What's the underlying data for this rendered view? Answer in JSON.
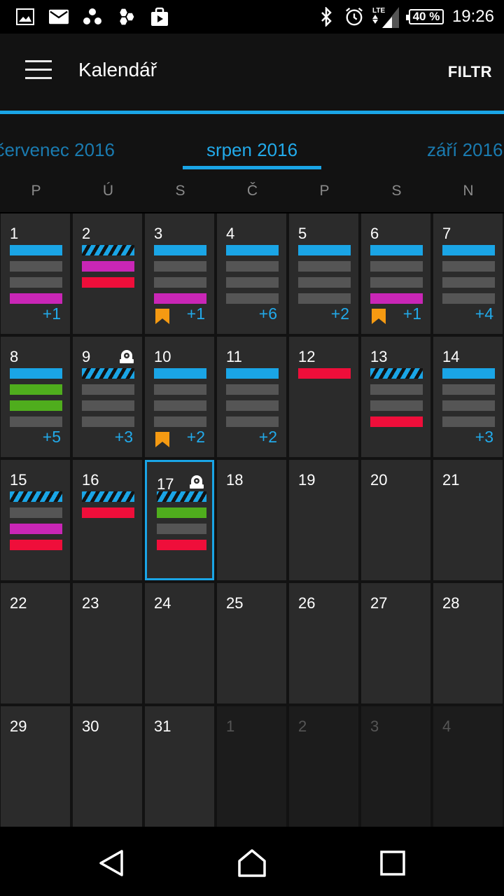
{
  "status_bar": {
    "battery": "40 %",
    "time": "19:26",
    "network": "LTE",
    "icons_left": [
      "image-icon",
      "mail-icon",
      "apps-icon",
      "hexagon-icon",
      "store-icon"
    ],
    "icons_right": [
      "bluetooth-icon",
      "alarm-icon",
      "lte-signal-icon",
      "battery-icon"
    ]
  },
  "app_bar": {
    "title": "Kalendář",
    "filter_label": "FILTR"
  },
  "month_tabs": {
    "prev": "červenec 2016",
    "current": "srpen 2016",
    "next": "září 2016"
  },
  "weekdays": [
    "P",
    "Ú",
    "S",
    "Č",
    "P",
    "S",
    "N"
  ],
  "colors": {
    "accent": "#1aa5e6",
    "gray_event": "#555555",
    "magenta_event": "#c926b6",
    "red_event": "#ef0e3a",
    "green_event": "#4fad1d",
    "bookmark": "#f59a12"
  },
  "calendar": {
    "today": "17",
    "weeks": [
      [
        {
          "day": "1",
          "events": [
            "blue",
            "gray",
            "gray",
            "magenta"
          ],
          "more": "+1",
          "bookmark": false,
          "alarm": false
        },
        {
          "day": "2",
          "events": [
            "striped",
            "magenta",
            "red"
          ],
          "more": "",
          "bookmark": false,
          "alarm": false
        },
        {
          "day": "3",
          "events": [
            "blue",
            "gray",
            "gray",
            "magenta"
          ],
          "more": "+1",
          "bookmark": true,
          "alarm": false
        },
        {
          "day": "4",
          "events": [
            "blue",
            "gray",
            "gray",
            "gray"
          ],
          "more": "+6",
          "bookmark": false,
          "alarm": false
        },
        {
          "day": "5",
          "events": [
            "blue",
            "gray",
            "gray",
            "gray"
          ],
          "more": "+2",
          "bookmark": false,
          "alarm": false
        },
        {
          "day": "6",
          "events": [
            "blue",
            "gray",
            "gray",
            "magenta"
          ],
          "more": "+1",
          "bookmark": true,
          "alarm": false
        },
        {
          "day": "7",
          "events": [
            "blue",
            "gray",
            "gray",
            "gray"
          ],
          "more": "+4",
          "bookmark": false,
          "alarm": false
        }
      ],
      [
        {
          "day": "8",
          "events": [
            "blue",
            "green",
            "green",
            "gray"
          ],
          "more": "+5",
          "bookmark": false,
          "alarm": false
        },
        {
          "day": "9",
          "events": [
            "striped",
            "gray",
            "gray",
            "gray"
          ],
          "more": "+3",
          "bookmark": false,
          "alarm": true
        },
        {
          "day": "10",
          "events": [
            "blue",
            "gray",
            "gray",
            "gray"
          ],
          "more": "+2",
          "bookmark": true,
          "alarm": false
        },
        {
          "day": "11",
          "events": [
            "blue",
            "gray",
            "gray",
            "gray"
          ],
          "more": "+2",
          "bookmark": false,
          "alarm": false
        },
        {
          "day": "12",
          "events": [
            "red"
          ],
          "more": "",
          "bookmark": false,
          "alarm": false
        },
        {
          "day": "13",
          "events": [
            "striped",
            "gray",
            "gray",
            "red"
          ],
          "more": "",
          "bookmark": false,
          "alarm": false
        },
        {
          "day": "14",
          "events": [
            "blue",
            "gray",
            "gray",
            "gray"
          ],
          "more": "+3",
          "bookmark": false,
          "alarm": false
        }
      ],
      [
        {
          "day": "15",
          "events": [
            "striped",
            "gray",
            "magenta",
            "red"
          ],
          "more": "",
          "bookmark": false,
          "alarm": false
        },
        {
          "day": "16",
          "events": [
            "striped",
            "red"
          ],
          "more": "",
          "bookmark": false,
          "alarm": false
        },
        {
          "day": "17",
          "events": [
            "striped",
            "green",
            "gray",
            "red"
          ],
          "more": "",
          "bookmark": false,
          "alarm": true
        },
        {
          "day": "18",
          "events": [],
          "more": "",
          "bookmark": false,
          "alarm": false
        },
        {
          "day": "19",
          "events": [],
          "more": "",
          "bookmark": false,
          "alarm": false
        },
        {
          "day": "20",
          "events": [],
          "more": "",
          "bookmark": false,
          "alarm": false
        },
        {
          "day": "21",
          "events": [],
          "more": "",
          "bookmark": false,
          "alarm": false
        }
      ],
      [
        {
          "day": "22",
          "events": [],
          "more": "",
          "bookmark": false,
          "alarm": false
        },
        {
          "day": "23",
          "events": [],
          "more": "",
          "bookmark": false,
          "alarm": false
        },
        {
          "day": "24",
          "events": [],
          "more": "",
          "bookmark": false,
          "alarm": false
        },
        {
          "day": "25",
          "events": [],
          "more": "",
          "bookmark": false,
          "alarm": false
        },
        {
          "day": "26",
          "events": [],
          "more": "",
          "bookmark": false,
          "alarm": false
        },
        {
          "day": "27",
          "events": [],
          "more": "",
          "bookmark": false,
          "alarm": false
        },
        {
          "day": "28",
          "events": [],
          "more": "",
          "bookmark": false,
          "alarm": false
        }
      ],
      [
        {
          "day": "29",
          "events": [],
          "more": "",
          "bookmark": false,
          "alarm": false
        },
        {
          "day": "30",
          "events": [],
          "more": "",
          "bookmark": false,
          "alarm": false
        },
        {
          "day": "31",
          "events": [],
          "more": "",
          "bookmark": false,
          "alarm": false
        },
        {
          "day": "1",
          "events": [],
          "more": "",
          "bookmark": false,
          "alarm": false,
          "other_month": true
        },
        {
          "day": "2",
          "events": [],
          "more": "",
          "bookmark": false,
          "alarm": false,
          "other_month": true
        },
        {
          "day": "3",
          "events": [],
          "more": "",
          "bookmark": false,
          "alarm": false,
          "other_month": true
        },
        {
          "day": "4",
          "events": [],
          "more": "",
          "bookmark": false,
          "alarm": false,
          "other_month": true
        }
      ]
    ]
  },
  "nav_bar": {
    "buttons": [
      "back-icon",
      "home-icon",
      "recents-icon"
    ]
  }
}
